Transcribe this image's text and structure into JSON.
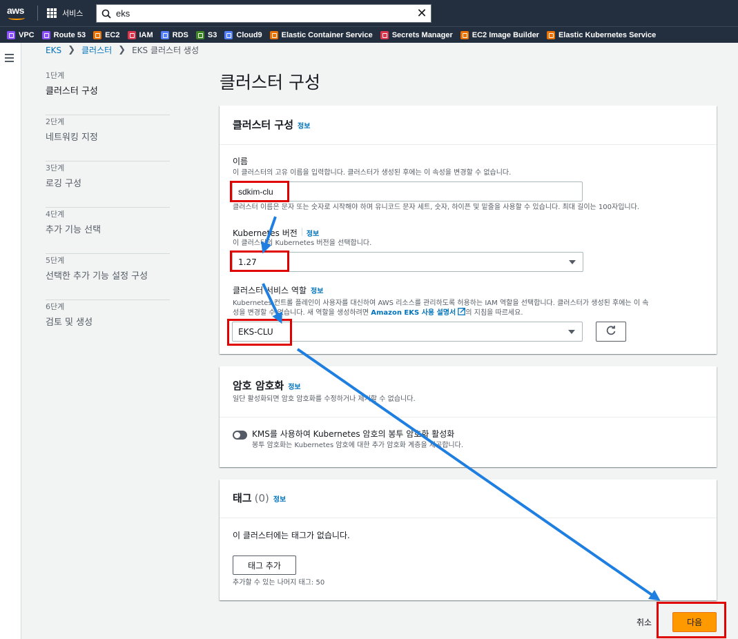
{
  "topbar": {
    "logo_text": "aws",
    "services_label": "서비스",
    "search_value": "eks"
  },
  "favorites": [
    {
      "label": "VPC",
      "color": "#8c4fff"
    },
    {
      "label": "Route 53",
      "color": "#8c4fff"
    },
    {
      "label": "EC2",
      "color": "#ed7100"
    },
    {
      "label": "IAM",
      "color": "#dd344c"
    },
    {
      "label": "RDS",
      "color": "#527fff"
    },
    {
      "label": "S3",
      "color": "#3f8624"
    },
    {
      "label": "Cloud9",
      "color": "#527fff"
    },
    {
      "label": "Elastic Container Service",
      "color": "#ed7100"
    },
    {
      "label": "Secrets Manager",
      "color": "#dd344c"
    },
    {
      "label": "EC2 Image Builder",
      "color": "#ed7100"
    },
    {
      "label": "Elastic Kubernetes Service",
      "color": "#ed7100"
    }
  ],
  "breadcrumb": {
    "root": "EKS",
    "parent": "클러스터",
    "current": "EKS 클러스터 생성"
  },
  "steps": [
    {
      "num": "1단계",
      "name": "클러스터 구성"
    },
    {
      "num": "2단계",
      "name": "네트워킹 지정"
    },
    {
      "num": "3단계",
      "name": "로깅 구성"
    },
    {
      "num": "4단계",
      "name": "추가 기능 선택"
    },
    {
      "num": "5단계",
      "name": "선택한 추가 기능 설정 구성"
    },
    {
      "num": "6단계",
      "name": "검토 및 생성"
    }
  ],
  "page_title": "클러스터 구성",
  "cluster_panel": {
    "heading": "클러스터 구성",
    "info": "정보",
    "name_label": "이름",
    "name_desc": "이 클러스터의 고유 이름을 입력합니다. 클러스터가 생성된 후에는 이 속성을 변경할 수 없습니다.",
    "name_value": "sdkim-clu",
    "name_hint": "클러스터 이름은 문자 또는 숫자로 시작해야 하며 유니코드 문자 세트, 숫자, 하이픈 및 밑줄을 사용할 수 있습니다. 최대 길이는 100자입니다.",
    "version_label": "Kubernetes 버전",
    "version_info": "정보",
    "version_desc": "이 클러스터의 Kubernetes 버전을 선택합니다.",
    "version_value": "1.27",
    "role_label": "클러스터 서비스 역할",
    "role_info": "정보",
    "role_desc_1": "Kubernetes 컨트롤 플레인이 사용자를 대신하여 AWS 리소스를 관리하도록 허용하는 IAM 역할을 선택합니다. 클러스터가 생성된 후에는 이 속",
    "role_desc_2a": "성을 변경할 수 없습니다. 새 역할을 생성하려면 ",
    "role_desc_link": "Amazon EKS 사용 설명서",
    "role_desc_2b": "의 지침을 따르세요.",
    "role_value": "EKS-CLU"
  },
  "encryption_panel": {
    "heading": "암호 암호화",
    "info": "정보",
    "desc": "일단 활성화되면 암호 암호화를 수정하거나 제거할 수 없습니다.",
    "toggle_label": "KMS를 사용하여 Kubernetes 암호의 봉투 암호화 활성화",
    "toggle_desc": "봉투 암호화는 Kubernetes 암호에 대한 추가 암호화 계층을 제공합니다."
  },
  "tags_panel": {
    "heading": "태그",
    "count": "(0)",
    "info": "정보",
    "empty": "이 클러스터에는 태그가 없습니다.",
    "add_button": "태그 추가",
    "remaining": "추가할 수 있는 나머지 태그: 50"
  },
  "footer": {
    "cancel": "취소",
    "next": "다음"
  }
}
